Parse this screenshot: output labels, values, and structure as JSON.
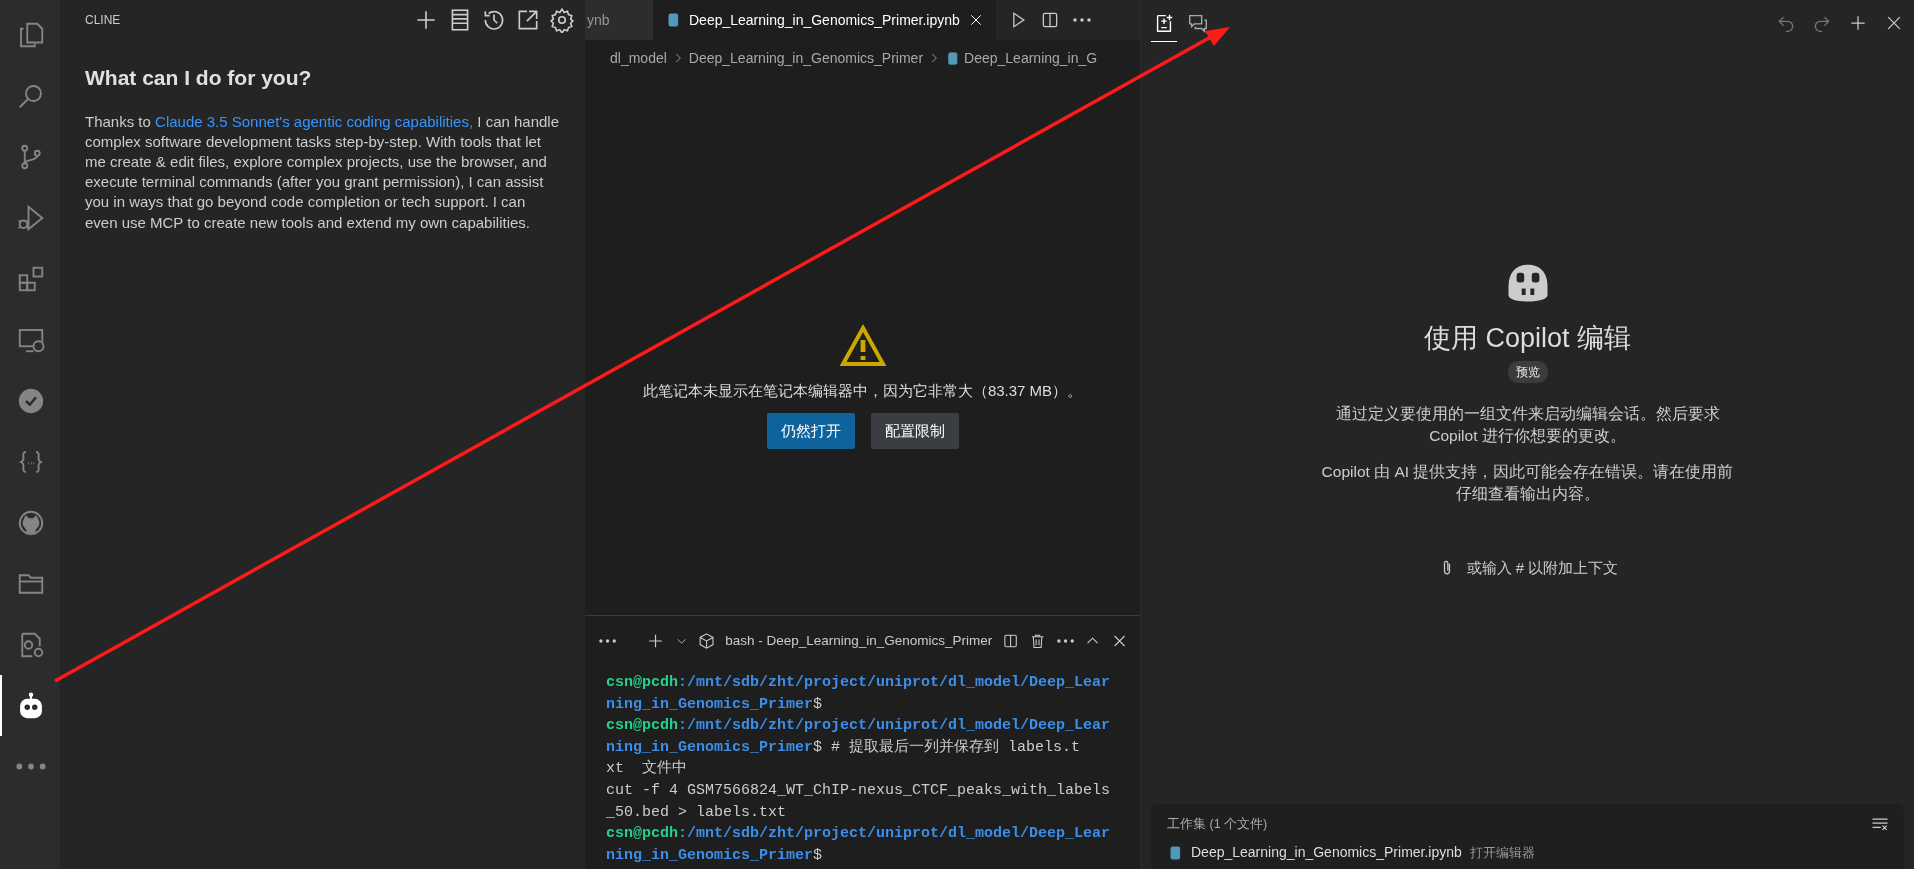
{
  "activity_bar": {
    "items": [
      {
        "kind": "files",
        "selected": false
      },
      {
        "kind": "search",
        "selected": false
      },
      {
        "kind": "branch",
        "selected": false
      },
      {
        "kind": "run",
        "selected": false
      },
      {
        "kind": "extensions",
        "selected": false
      },
      {
        "kind": "remote",
        "selected": false
      },
      {
        "kind": "check",
        "selected": false
      },
      {
        "kind": "braces",
        "selected": false
      },
      {
        "kind": "github",
        "selected": false
      },
      {
        "kind": "folder",
        "selected": false
      },
      {
        "kind": "gearfile",
        "selected": false
      },
      {
        "kind": "robot",
        "selected": true
      },
      {
        "kind": "more",
        "selected": false
      }
    ]
  },
  "cline": {
    "title": "CLINE",
    "actions": [
      {
        "kind": "plus"
      },
      {
        "kind": "servers"
      },
      {
        "kind": "history"
      },
      {
        "kind": "popout"
      },
      {
        "kind": "settings"
      }
    ],
    "heading": "What can I do for you?",
    "intro": {
      "before": "Thanks to ",
      "link": "Claude 3.5 Sonnet's agentic coding capabilities,",
      "after": " I can handle complex software development tasks step-by-step. With tools that let me create & edit files, explore complex projects, use the browser, and execute terminal commands (after you grant permission), I can assist you in ways that go beyond code completion or tech support. I can even use MCP to create new tools and extend my own capabilities."
    }
  },
  "editor": {
    "tabs": [
      {
        "label": "ynb",
        "selected": false
      },
      {
        "label": "Deep_Learning_in_Genomics_Primer.ipynb",
        "selected": true
      }
    ],
    "actions": [
      {
        "kind": "play"
      },
      {
        "kind": "split"
      },
      {
        "kind": "more"
      }
    ],
    "breadcrumbs": [
      {
        "label": "dl_model",
        "kind": "folder"
      },
      {
        "label": "Deep_Learning_in_Genomics_Primer",
        "kind": "folder"
      },
      {
        "label": "Deep_Learning_in_G",
        "kind": "notebook"
      }
    ],
    "notice": {
      "message": "此笔记本未显示在笔记本编辑器中，因为它非常大（83.37 MB）。",
      "buttons": [
        {
          "label": "仍然打开",
          "kind": "primary"
        },
        {
          "label": "配置限制",
          "kind": "secondary"
        }
      ]
    }
  },
  "terminal": {
    "title": "bash - Deep_Learning_in_Genomics_Primer",
    "lines": [
      [
        {
          "kind": "user",
          "text": "csn@pcdh"
        },
        {
          "kind": "path",
          "text": ":/mnt/sdb/zht/project/uniprot/dl_model/Deep_Lear"
        }
      ],
      [
        {
          "kind": "path",
          "text": "ning_in_Genomics_Primer"
        },
        {
          "kind": "plain",
          "text": "$"
        }
      ],
      [
        {
          "kind": "user",
          "text": "csn@pcdh"
        },
        {
          "kind": "path",
          "text": ":/mnt/sdb/zht/project/uniprot/dl_model/Deep_Lear"
        }
      ],
      [
        {
          "kind": "path",
          "text": "ning_in_Genomics_Primer"
        },
        {
          "kind": "plain",
          "text": "$ # 提取最后一列并保存到 labels.t"
        }
      ],
      [
        {
          "kind": "plain",
          "text": "xt  文件中"
        }
      ],
      [
        {
          "kind": "plain",
          "text": "cut -f 4 GSM7566824_WT_ChIP-nexus_CTCF_peaks_with_labels"
        }
      ],
      [
        {
          "kind": "plain",
          "text": "_50.bed > labels.txt"
        }
      ],
      [
        {
          "kind": "user",
          "text": "csn@pcdh"
        },
        {
          "kind": "path",
          "text": ":/mnt/sdb/zht/project/uniprot/dl_model/Deep_Lear"
        }
      ],
      [
        {
          "kind": "path",
          "text": "ning_in_Genomics_Primer"
        },
        {
          "kind": "plain",
          "text": "$"
        }
      ]
    ]
  },
  "copilot": {
    "tabs": [
      {
        "kind": "edits",
        "selected": true
      },
      {
        "kind": "chat",
        "selected": false
      }
    ],
    "actions": [
      {
        "kind": "undo"
      },
      {
        "kind": "redo"
      },
      {
        "kind": "plus"
      },
      {
        "kind": "close"
      }
    ],
    "title": "使用 Copilot 编辑",
    "badge": "预览",
    "paragraphs": [
      "通过定义要使用的一组文件来启动编辑会话。然后要求 Copilot 进行你想要的更改。",
      "Copilot 由 AI 提供支持，因此可能会存在错误。请在使用前仔细查看输出内容。"
    ],
    "hint": "或输入 # 以附加上下文",
    "working_set": {
      "title": "工作集 (1 个文件)",
      "files": [
        {
          "name": "Deep_Learning_in_Genomics_Primer.ipynb",
          "action": "打开编辑器"
        }
      ]
    }
  }
}
